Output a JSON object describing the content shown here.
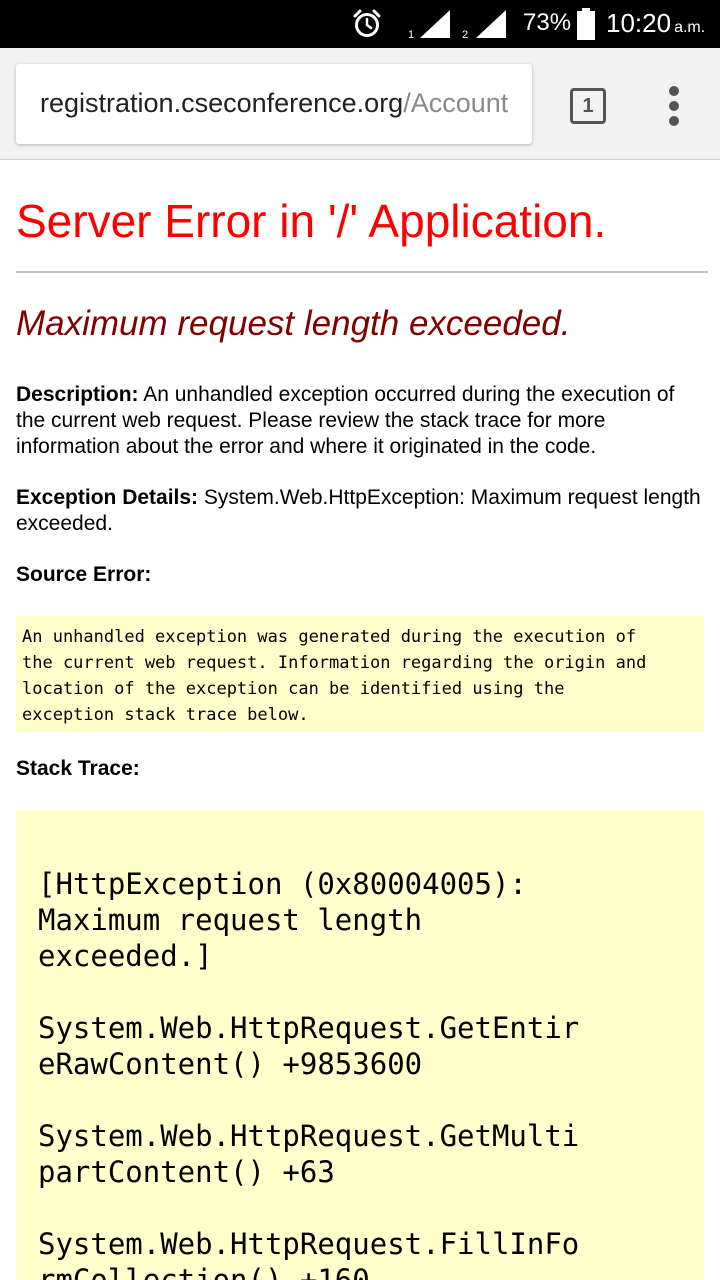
{
  "status_bar": {
    "alarm_icon": "alarm-clock-icon",
    "sim1_label": "1",
    "sim2_label": "2",
    "battery_percent": "73%",
    "time": "10:20",
    "ampm": "a.m."
  },
  "browser": {
    "url_host": "registration.cseconference.org",
    "url_path": "/Account",
    "tab_count": "1",
    "menu_icon": "overflow-menu-icon"
  },
  "page": {
    "title": "Server Error in '/' Application.",
    "subtitle": "Maximum request length exceeded.",
    "description_label": "Description:",
    "description_text": " An unhandled exception occurred during the execution of the current web request. Please review the stack trace for more information about the error and where it originated in the code.",
    "exception_label": "Exception Details:",
    "exception_text": " System.Web.HttpException: Maximum request length exceeded.",
    "source_error_heading": "Source Error:",
    "source_error_text": "An unhandled exception was generated during the execution of\nthe current web request. Information regarding the origin and\nlocation of the exception can be identified using the\nexception stack trace below.",
    "stack_trace_heading": "Stack Trace:",
    "stack_lines": [
      "[HttpException (0x80004005):",
      "Maximum request length",
      "exceeded.]",
      "",
      "System.Web.HttpRequest.GetEntir",
      "eRawContent() +9853600",
      "",
      "System.Web.HttpRequest.GetMulti",
      "partContent() +63",
      "",
      "System.Web.HttpRequest.FillInFo",
      "rmCollection() +160"
    ]
  },
  "colors": {
    "title_red": "#ff0000",
    "subtitle_maroon": "#800000",
    "code_bg": "#ffffcc"
  }
}
